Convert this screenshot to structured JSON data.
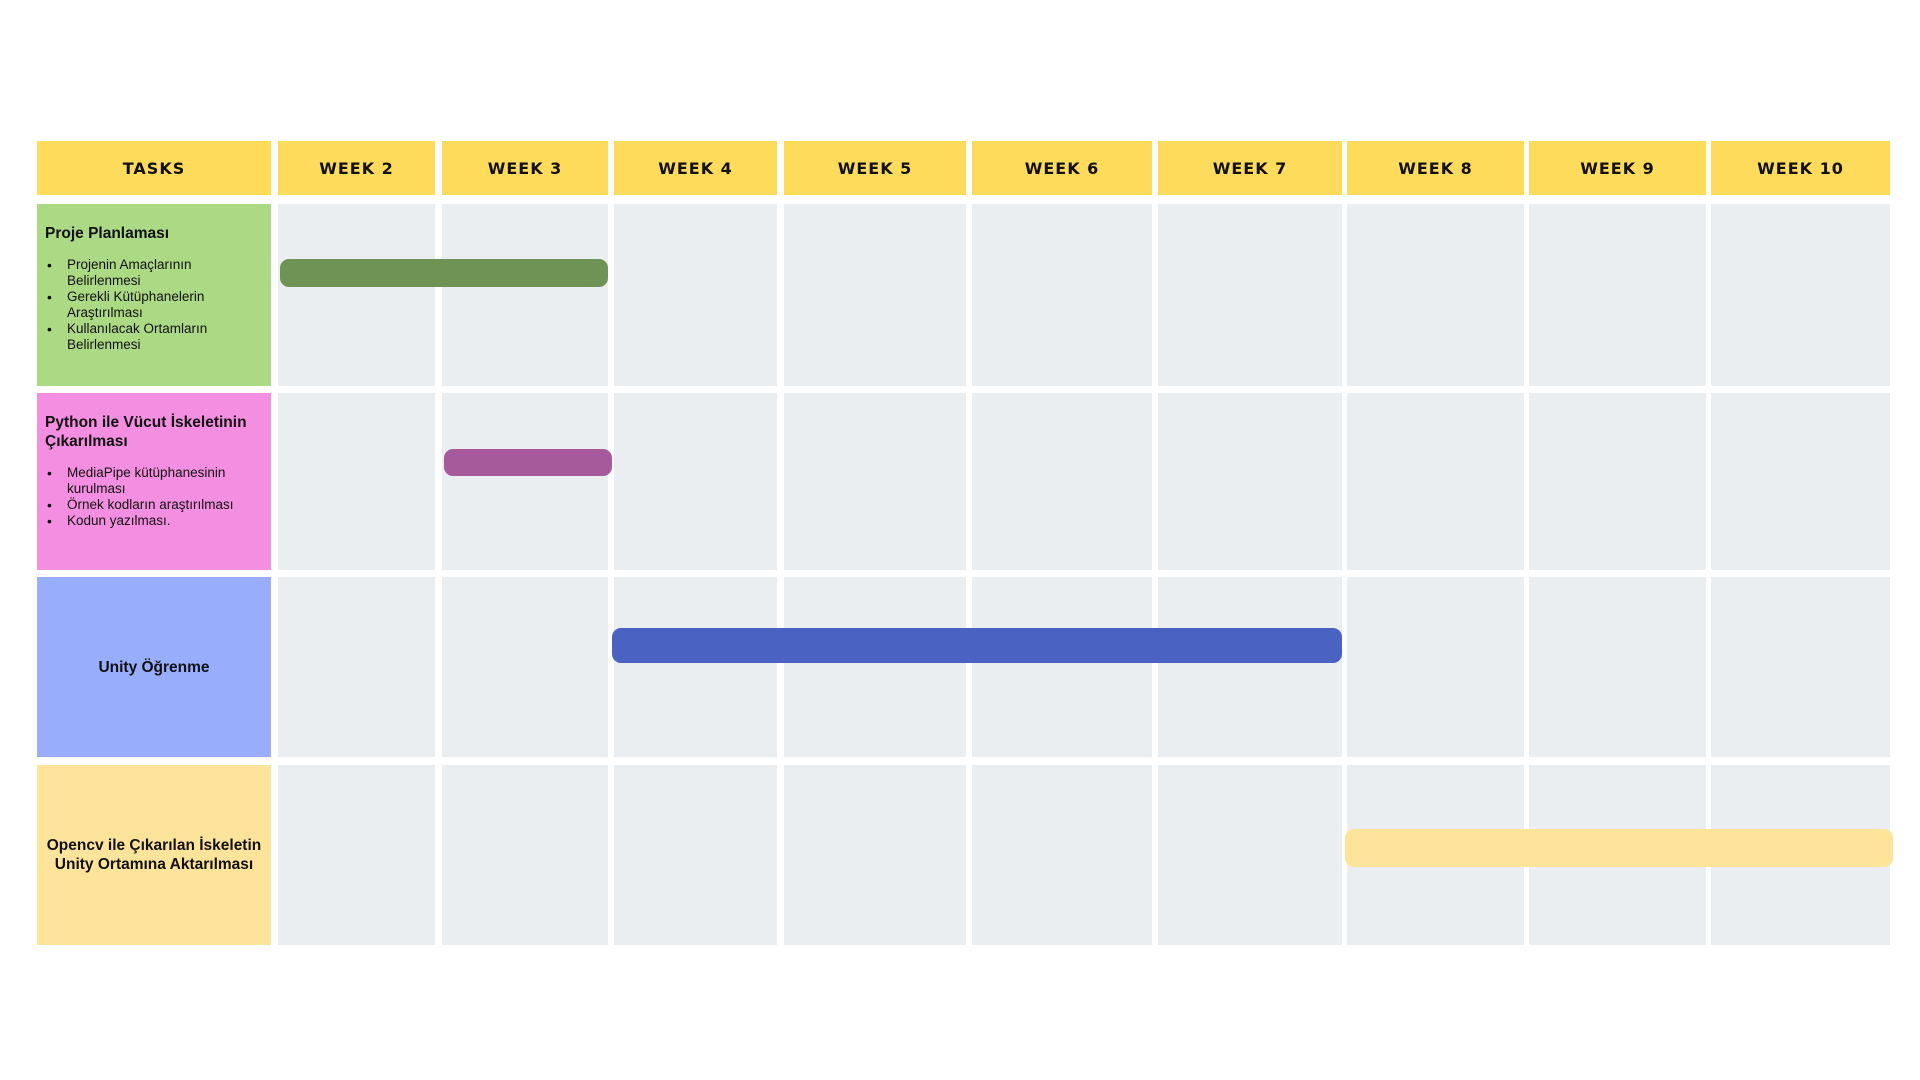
{
  "headers": {
    "tasks": "TASKS",
    "weeks": [
      "WEEK 2",
      "WEEK 3",
      "WEEK 4",
      "WEEK 5",
      "WEEK 6",
      "WEEK 7",
      "WEEK 8",
      "WEEK 9",
      "WEEK 10"
    ]
  },
  "tasks": [
    {
      "title": "Proje Planlaması",
      "items": [
        "Projenin Amaçlarının Belirlenmesi",
        "Gerekli Kütüphanelerin Araştırılması",
        "Kullanılacak Ortamların Belirlenmesi"
      ],
      "color": "#acd984",
      "bar": {
        "start": "WEEK 2",
        "end": "WEEK 3",
        "color": "#6f9354"
      }
    },
    {
      "title": "Python ile Vücut İskeletinin Çıkarılması",
      "items": [
        "MediaPipe kütüphanesinin kurulması",
        "Örnek kodların araştırılması",
        "Kodun yazılması."
      ],
      "color": "#f48ee0",
      "bar": {
        "start": "WEEK 3",
        "end": "WEEK 3",
        "color": "#a75a9b"
      }
    },
    {
      "title": "Unity Öğrenme",
      "items": [],
      "color": "#99adfd",
      "bar": {
        "start": "WEEK 4",
        "end": "WEEK 7",
        "color": "#4a62c1"
      }
    },
    {
      "title": "Opencv ile Çıkarılan İskeletin Unity Ortamına Aktarılması",
      "items": [],
      "color": "#fee39a",
      "bar": {
        "start": "WEEK 8",
        "end": "WEEK 10",
        "color": "#fee39a"
      }
    }
  ]
}
